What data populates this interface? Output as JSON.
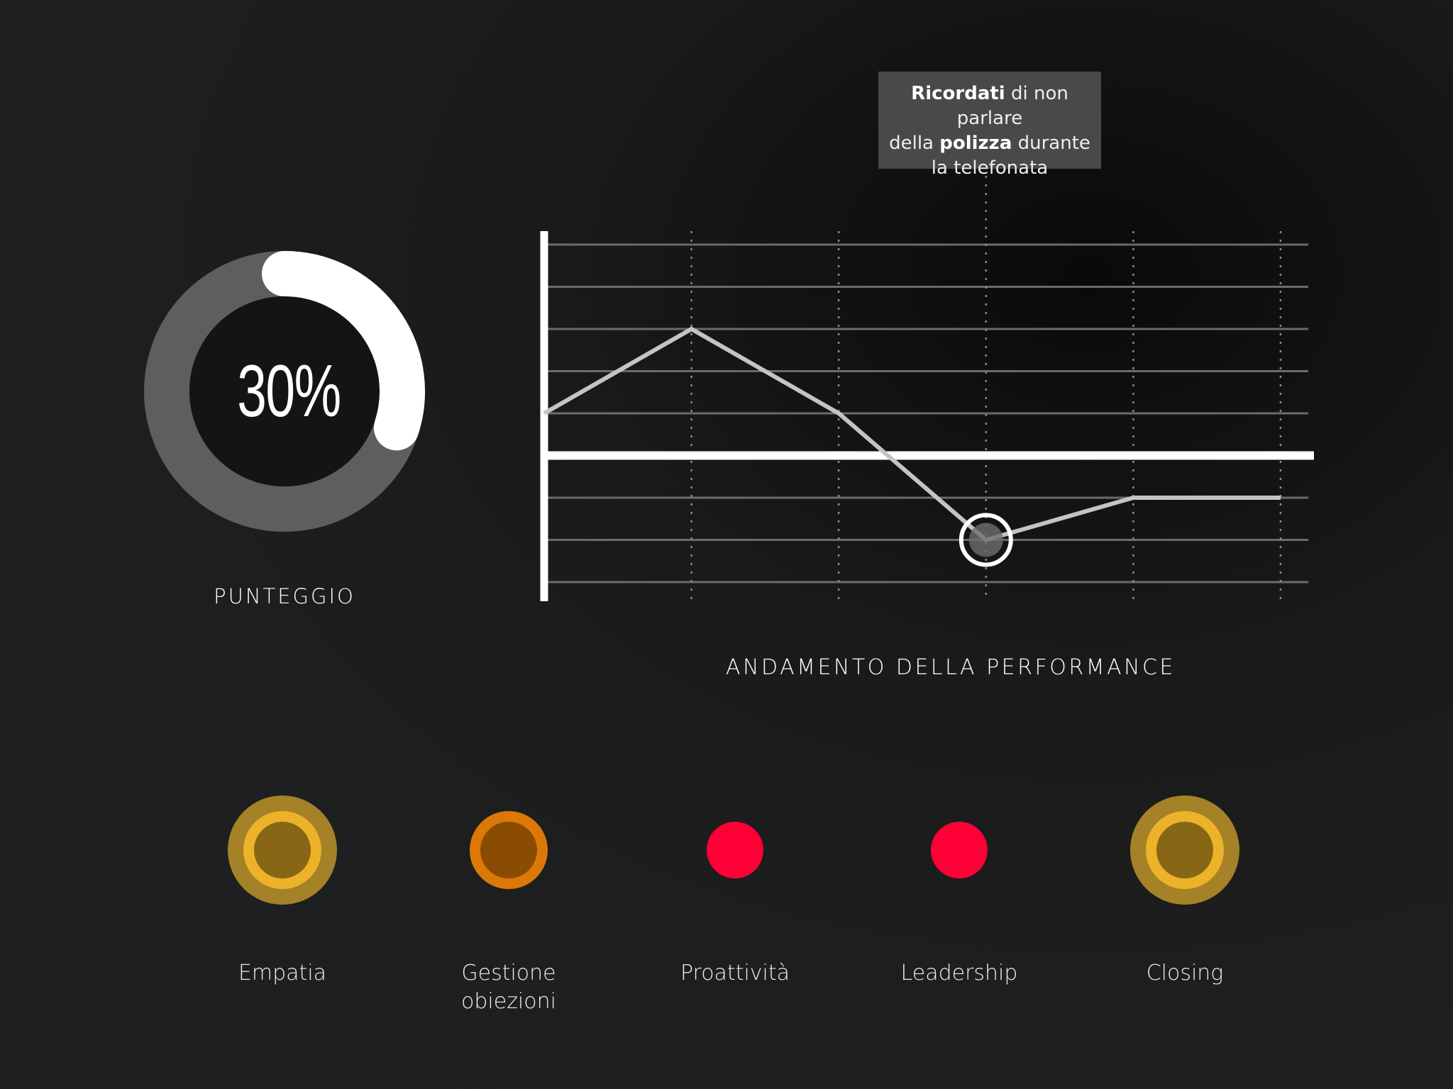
{
  "score": {
    "value_percent": 30,
    "display": "30%",
    "label": "PUNTEGGIO"
  },
  "tooltip": {
    "bold1": "Ricordati",
    "text1": " di non parlare",
    "text2a": "della ",
    "bold2": "polizza",
    "text2b": " durante",
    "text3": "la telefonata"
  },
  "chart_data": {
    "type": "line",
    "title": "ANDAMENTO DELLA PERFORMANCE",
    "x": [
      0,
      1,
      2,
      3,
      4,
      5
    ],
    "values": [
      1,
      3,
      1,
      -2,
      -1,
      -1
    ],
    "ylim": [
      -3,
      5
    ],
    "baseline": 0,
    "highlight_index": 3,
    "grid": true
  },
  "skills": [
    {
      "label": "Empatia",
      "status": "gold",
      "colors": {
        "outer": "#a58127",
        "ring": "#ecb32a",
        "inner": "#876616"
      }
    },
    {
      "label": "Gestione obiezioni",
      "line1": "Gestione",
      "line2": "obiezioni",
      "status": "orange",
      "colors": {
        "ring": "#dc7806",
        "inner": "#8a4b03"
      }
    },
    {
      "label": "Proattività",
      "status": "red",
      "colors": {
        "fill": "#ff0036"
      }
    },
    {
      "label": "Leadership",
      "status": "red",
      "colors": {
        "fill": "#ff0036"
      }
    },
    {
      "label": "Closing",
      "status": "gold",
      "colors": {
        "outer": "#a58127",
        "ring": "#ecb32a",
        "inner": "#876616"
      }
    }
  ]
}
